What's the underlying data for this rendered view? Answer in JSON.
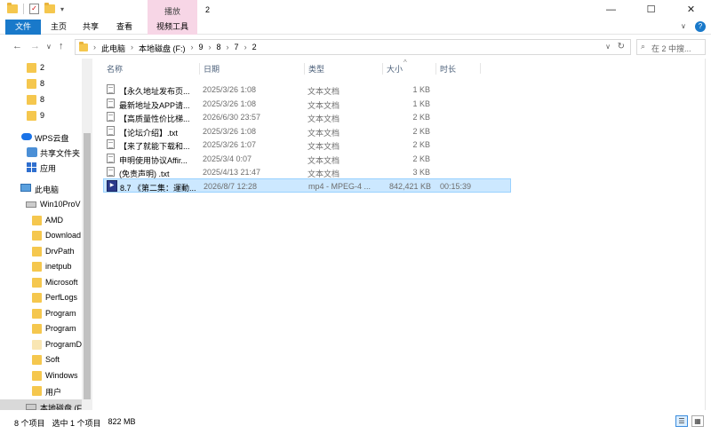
{
  "titlebar": {
    "context_tab": "播放",
    "title": "2",
    "minimize": "—",
    "maximize": "☐",
    "close": "✕"
  },
  "ribbon": {
    "tabs": [
      "文件",
      "主页",
      "共享",
      "查看",
      "视频工具"
    ],
    "expand": "∨",
    "help": "?"
  },
  "nav": {
    "back": "←",
    "forward": "→",
    "recent": "∨",
    "up": "↑"
  },
  "address": {
    "crumbs": [
      "此电脑",
      "本地磁盘 (F:)",
      "9",
      "8",
      "7",
      "2"
    ],
    "separator": "›",
    "dropdown": "∨",
    "refresh": "↻"
  },
  "search": {
    "placeholder": "在 2 中搜...",
    "icon": "search-icon"
  },
  "sidebar": {
    "items": [
      {
        "label": "2",
        "type": "folder"
      },
      {
        "label": "8",
        "type": "folder"
      },
      {
        "label": "8",
        "type": "folder"
      },
      {
        "label": "9",
        "type": "folder"
      },
      {
        "label": "WPS云盘",
        "type": "cloud"
      },
      {
        "label": "共享文件夹",
        "type": "share"
      },
      {
        "label": "应用",
        "type": "apps"
      },
      {
        "label": "此电脑",
        "type": "pc"
      },
      {
        "label": "Win10ProV",
        "type": "drive"
      },
      {
        "label": "AMD",
        "type": "folder"
      },
      {
        "label": "Download",
        "type": "folder"
      },
      {
        "label": "DrvPath",
        "type": "folder"
      },
      {
        "label": "inetpub",
        "type": "folder"
      },
      {
        "label": "Microsoft",
        "type": "folder"
      },
      {
        "label": "PerfLogs",
        "type": "folder"
      },
      {
        "label": "Program",
        "type": "folder"
      },
      {
        "label": "Program",
        "type": "folder"
      },
      {
        "label": "ProgramD",
        "type": "folder"
      },
      {
        "label": "Soft",
        "type": "folder"
      },
      {
        "label": "Windows",
        "type": "folder"
      },
      {
        "label": "用户",
        "type": "folder"
      },
      {
        "label": "本地磁盘 (F",
        "type": "drive"
      }
    ]
  },
  "columns": {
    "name": "名称",
    "date": "日期",
    "type": "类型",
    "size": "大小",
    "duration": "时长",
    "sort_indicator": "^"
  },
  "files": [
    {
      "name": "【永久地址发布页...",
      "date": "2025/3/26 1:08",
      "type": "文本文档",
      "size": "1 KB",
      "duration": "",
      "icon": "text-file-icon"
    },
    {
      "name": "最新地址及APP请...",
      "date": "2025/3/26 1:08",
      "type": "文本文档",
      "size": "1 KB",
      "duration": "",
      "icon": "text-file-icon"
    },
    {
      "name": "【高质量性价比梯...",
      "date": "2026/6/30 23:57",
      "type": "文本文档",
      "size": "2 KB",
      "duration": "",
      "icon": "text-file-icon"
    },
    {
      "name": "【论坛介绍】.txt",
      "date": "2025/3/26 1:08",
      "type": "文本文档",
      "size": "2 KB",
      "duration": "",
      "icon": "text-file-icon"
    },
    {
      "name": "【来了就能下载和...",
      "date": "2025/3/26 1:07",
      "type": "文本文档",
      "size": "2 KB",
      "duration": "",
      "icon": "text-file-icon"
    },
    {
      "name": "申明使用协议Affir...",
      "date": "2025/3/4 0:07",
      "type": "文本文档",
      "size": "2 KB",
      "duration": "",
      "icon": "text-file-icon"
    },
    {
      "name": "(免责声明) .txt",
      "date": "2025/4/13 21:47",
      "type": "文本文档",
      "size": "3 KB",
      "duration": "",
      "icon": "text-file-icon"
    },
    {
      "name": "8.7 《第二集：運動...",
      "date": "2026/8/7 12:28",
      "type": "mp4 - MPEG-4 ...",
      "size": "842,421 KB",
      "duration": "00:15:39",
      "icon": "video-file-icon",
      "selected": true
    }
  ],
  "status": {
    "count": "8 个项目",
    "selected": "选中 1 个项目",
    "size": "822 MB"
  },
  "colors": {
    "accent": "#1979ca",
    "selection": "#cce8ff",
    "context_tab": "#f7d6e6",
    "folder": "#f5c74e"
  }
}
